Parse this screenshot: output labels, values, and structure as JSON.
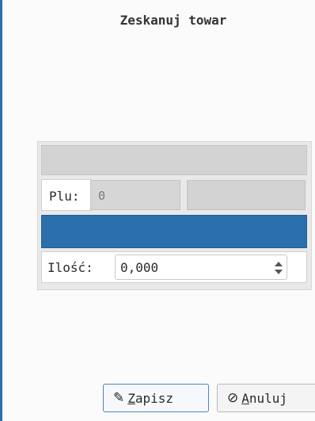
{
  "dialog": {
    "title": "Zeskanuj towar"
  },
  "form": {
    "plu_label": "Plu:",
    "plu_value": "0",
    "qty_label": "Ilość:",
    "qty_value": "0,000"
  },
  "buttons": {
    "save_access": "Z",
    "save_rest": "apisz",
    "save_icon": "pencil-icon",
    "cancel_access": "A",
    "cancel_rest": "nuluj",
    "cancel_icon": "cancel-icon"
  },
  "colors": {
    "accent": "#2c6fad",
    "panel": "#e9e9e9",
    "field_disabled": "#d3d3d3"
  }
}
